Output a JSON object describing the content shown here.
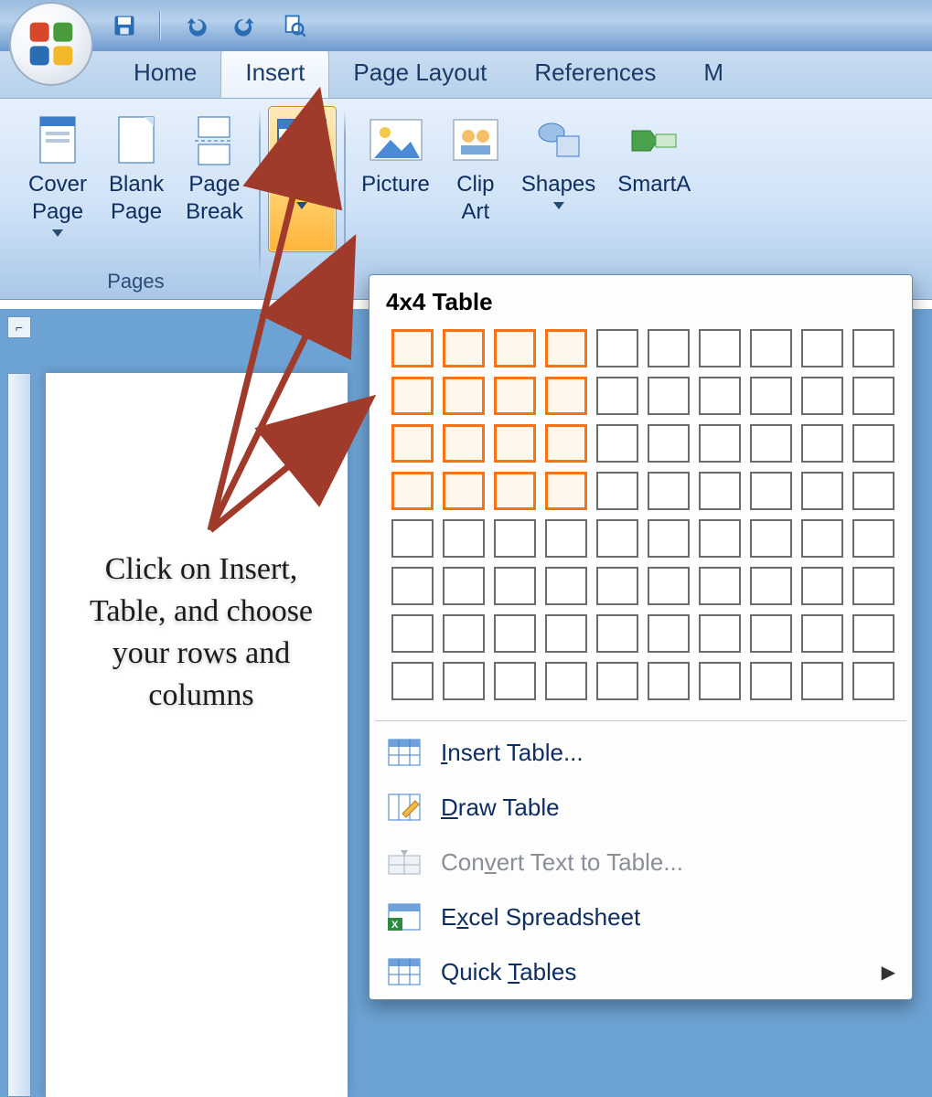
{
  "qat": {
    "buttons": [
      "save",
      "undo",
      "redo",
      "print-preview"
    ]
  },
  "tabs": [
    {
      "label": "Home",
      "active": false
    },
    {
      "label": "Insert",
      "active": true
    },
    {
      "label": "Page Layout",
      "active": false
    },
    {
      "label": "References",
      "active": false
    },
    {
      "label": "M",
      "active": false
    }
  ],
  "ribbon": {
    "pages_group_label": "Pages",
    "cover_page": "Cover\nPage",
    "blank_page": "Blank\nPage",
    "page_break": "Page\nBreak",
    "table": "Table",
    "picture": "Picture",
    "clip_art": "Clip\nArt",
    "shapes": "Shapes",
    "smartart": "SmartA"
  },
  "table_menu": {
    "title": "4x4 Table",
    "grid_cols": 10,
    "grid_rows": 8,
    "sel_cols": 4,
    "sel_rows": 4,
    "items": [
      {
        "label": "Insert Table...",
        "ul": "I",
        "icon": "table-icon",
        "disabled": false
      },
      {
        "label": "Draw Table",
        "ul": "D",
        "icon": "pencil-table-icon",
        "disabled": false
      },
      {
        "label": "Convert Text to Table...",
        "ul": "V",
        "icon": "convert-icon",
        "disabled": true
      },
      {
        "label": "Excel Spreadsheet",
        "ul": "X",
        "icon": "excel-icon",
        "disabled": false
      },
      {
        "label": "Quick Tables",
        "ul": "T",
        "icon": "quick-tables-icon",
        "disabled": false,
        "submenu": true
      }
    ]
  },
  "annotation": "Click on Insert, Table, and choose your rows and columns",
  "corner_marker": "⌐"
}
